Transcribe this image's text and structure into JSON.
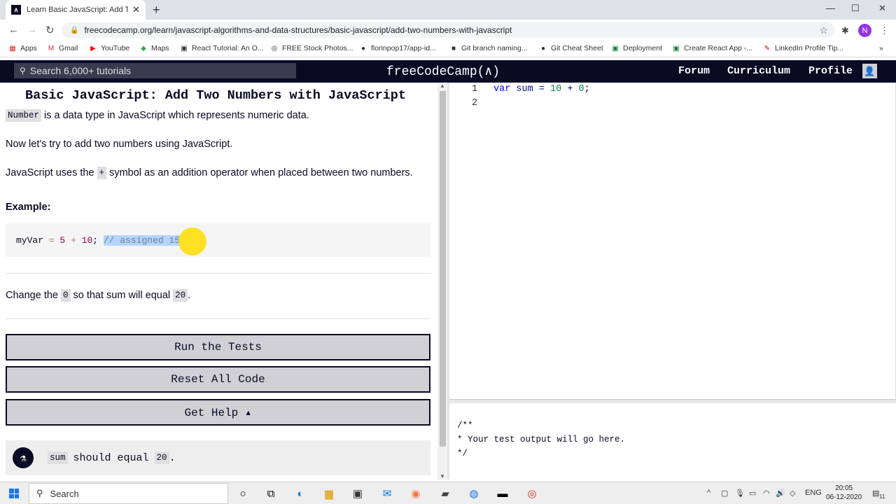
{
  "browser": {
    "tab_title": "Learn Basic JavaScript: Add Two Numbers with JavaScript",
    "tab_title_visible": "Learn Basic JavaScript: Add Two N",
    "tab_favicon": "∧",
    "url": "freecodecamp.org/learn/javascript-algorithms-and-data-structures/basic-javascript/add-two-numbers-with-javascript",
    "profile_initial": "N",
    "bookmarks": [
      {
        "label": "Apps",
        "icon": "apps-icon"
      },
      {
        "label": "Gmail",
        "icon": "gmail-icon"
      },
      {
        "label": "YouTube",
        "icon": "youtube-icon"
      },
      {
        "label": "Maps",
        "icon": "maps-icon"
      },
      {
        "label": "React Tutorial: An O...",
        "icon": "page-icon"
      },
      {
        "label": "FREE Stock Photos...",
        "icon": "camera-icon"
      },
      {
        "label": "florinpop17/app-id...",
        "icon": "github-icon"
      },
      {
        "label": "Git branch naming...",
        "icon": "bookmark-icon"
      },
      {
        "label": "Git Cheat Sheet",
        "icon": "github-icon"
      },
      {
        "label": "Deployment",
        "icon": "page-icon"
      },
      {
        "label": "Create React App -...",
        "icon": "page-icon"
      },
      {
        "label": "LinkedIn Profile Tip...",
        "icon": "pin-icon"
      }
    ]
  },
  "fcc_nav": {
    "search_placeholder": "Search 6,000+ tutorials",
    "logo": "freeCodeCamp(∧)",
    "links": [
      "Forum",
      "Curriculum",
      "Profile"
    ]
  },
  "lesson": {
    "title": "Basic JavaScript: Add Two Numbers with JavaScript",
    "p1_code": "Number",
    "p1_text": "is a data type in JavaScript which represents numeric data.",
    "p2": "Now let's try to add two numbers using JavaScript.",
    "p3_before": "JavaScript uses the",
    "p3_code": "+",
    "p3_after": "symbol as an addition operator when placed between two numbers.",
    "example_label": "Example:",
    "example_code": {
      "var": "myVar",
      "eq": " = ",
      "a": "5",
      "plus": " + ",
      "b": "10",
      "semi": "; ",
      "comment": "// assigned 15"
    },
    "task_before": "Change the",
    "task_code1": "0",
    "task_middle": "so that sum will equal",
    "task_code2": "20",
    "task_after": "."
  },
  "buttons": {
    "run": "Run the Tests",
    "reset": "Reset All Code",
    "help": "Get Help ▴"
  },
  "test": {
    "code1": "sum",
    "text": "should equal",
    "code2": "20",
    "end": "."
  },
  "editor": {
    "lines": [
      "1",
      "2"
    ],
    "line1_kw": "var",
    "line1_name": " sum = ",
    "line1_a": "10",
    "line1_op": " + ",
    "line1_b": "0",
    "line1_end": ";"
  },
  "output": {
    "text": "/**\n* Your test output will go here.\n*/"
  },
  "taskbar": {
    "search": "Search",
    "lang": "ENG",
    "time": "20:05",
    "date": "06-12-2020",
    "notification_count": "11"
  }
}
